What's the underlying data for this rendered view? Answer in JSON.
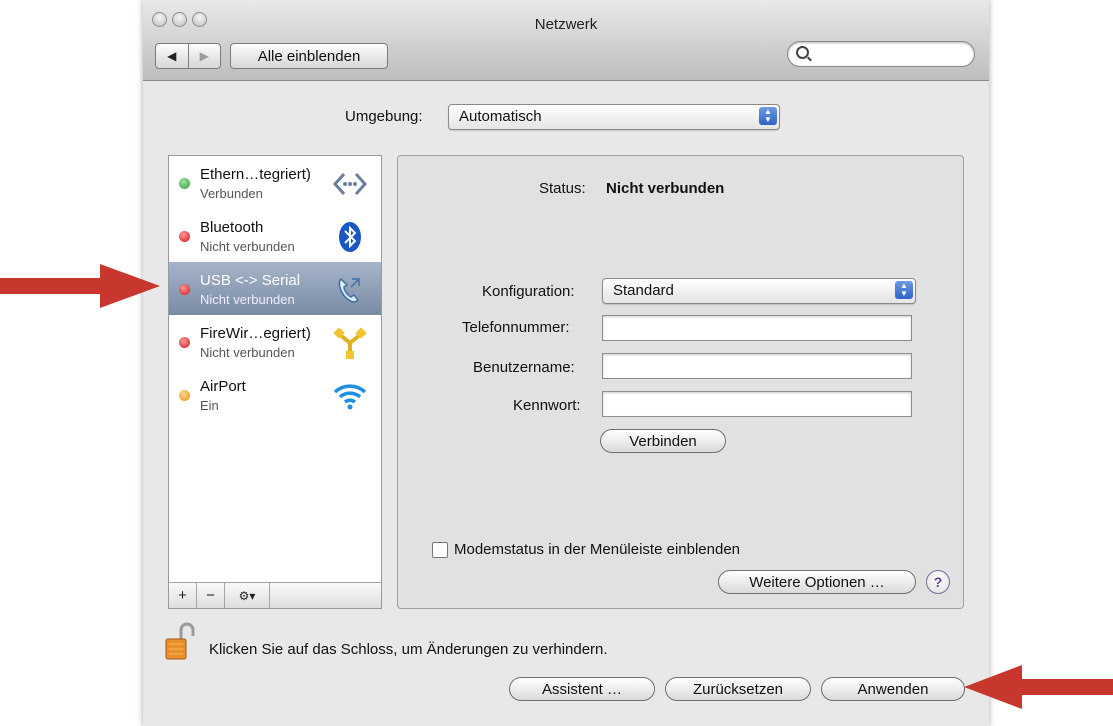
{
  "window": {
    "title": "Netzwerk"
  },
  "toolbar": {
    "back_icon": "◀",
    "forward_icon": "▶",
    "show_all_label": "Alle einblenden",
    "search_placeholder": ""
  },
  "location": {
    "label": "Umgebung:",
    "value": "Automatisch"
  },
  "services": [
    {
      "name": "Ethern…tegriert)",
      "status": "Verbunden",
      "dot_color": "#3cb043",
      "icon": "ethernet-icon",
      "selected": false
    },
    {
      "name": "Bluetooth",
      "status": "Nicht verbunden",
      "dot_color": "#e0202a",
      "icon": "bluetooth-icon",
      "selected": false
    },
    {
      "name": "USB <-> Serial",
      "status": "Nicht verbunden",
      "dot_color": "#e0202a",
      "icon": "phone-icon",
      "selected": true
    },
    {
      "name": "FireWir…egriert)",
      "status": "Nicht verbunden",
      "dot_color": "#e0202a",
      "icon": "firewire-icon",
      "selected": false
    },
    {
      "name": "AirPort",
      "status": "Ein",
      "dot_color": "#f5a623",
      "icon": "wifi-icon",
      "selected": false
    }
  ],
  "sidebar_bar": {
    "add": "+",
    "remove": "−",
    "gear": "⚙▾"
  },
  "detail": {
    "status_label": "Status:",
    "status_value": "Nicht verbunden",
    "config_label": "Konfiguration:",
    "config_value": "Standard",
    "phone_label": "Telefonnummer:",
    "phone_value": "",
    "user_label": "Benutzername:",
    "user_value": "",
    "password_label": "Kennwort:",
    "password_value": "",
    "connect_button": "Verbinden",
    "modem_checkbox_label": "Modemstatus in der Menüleiste einblenden",
    "more_options_button": "Weitere Optionen …",
    "help_label": "?"
  },
  "footer": {
    "lock_text": "Klicken Sie auf das Schloss, um Änderungen zu verhindern.",
    "assistant_button": "Assistent …",
    "revert_button": "Zurücksetzen",
    "apply_button": "Anwenden"
  },
  "colors": {
    "arrow": "#c8372d",
    "selection": "#8a9ab2"
  }
}
